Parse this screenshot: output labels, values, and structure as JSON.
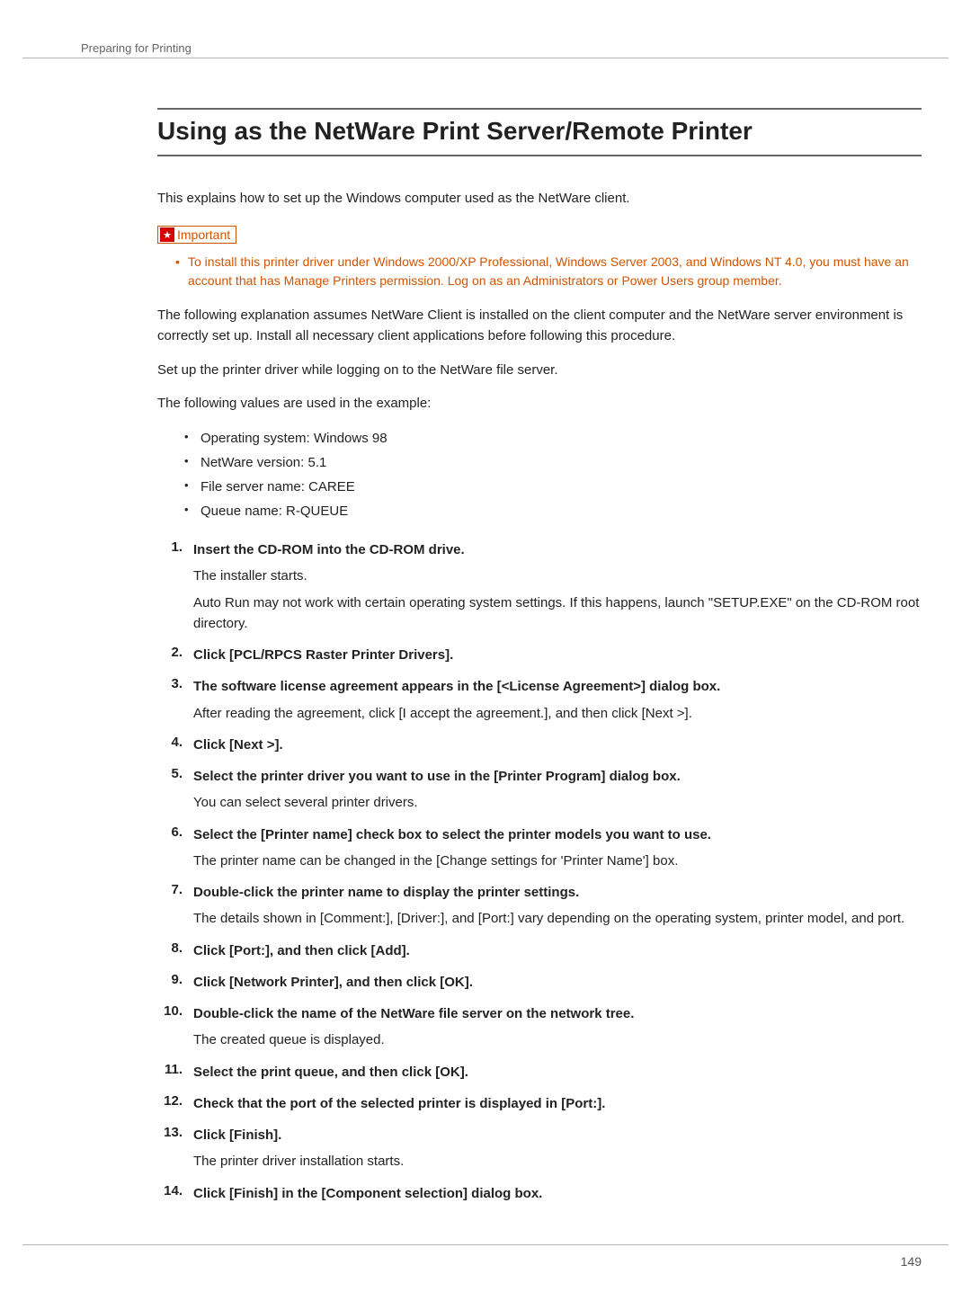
{
  "header": {
    "section": "Preparing for Printing"
  },
  "title": "Using as the NetWare Print Server/Remote Printer",
  "intro": "This explains how to set up the Windows computer used as the NetWare client.",
  "important": {
    "icon_name": "star-icon",
    "label": "Important",
    "bullet": "To install this printer driver under Windows 2000/XP Professional, Windows Server 2003, and Windows NT 4.0, you must have an account that has Manage Printers permission. Log on as an Administrators or Power Users group member."
  },
  "paras": {
    "p1": "The following explanation assumes NetWare Client is installed on the client computer and the NetWare server environment is correctly set up. Install all necessary client applications before following this procedure.",
    "p2": "Set up the printer driver while logging on to the NetWare file server.",
    "p3": "The following values are used in the example:"
  },
  "values": {
    "os": "Operating system: Windows 98",
    "nw": "NetWare version: 5.1",
    "fs": "File server name: CAREE",
    "qn": "Queue name: R-QUEUE"
  },
  "steps": {
    "s1_title": "Insert the CD-ROM into the CD-ROM drive.",
    "s1_body1": "The installer starts.",
    "s1_body2": "Auto Run may not work with certain operating system settings. If this happens, launch \"SETUP.EXE\" on the CD-ROM root directory.",
    "s2_title": "Click [PCL/RPCS Raster Printer Drivers].",
    "s3_title": "The software license agreement appears in the [<License Agreement>] dialog box.",
    "s3_body1": "After reading the agreement, click [I accept the agreement.], and then click [Next >].",
    "s4_title": "Click [Next >].",
    "s5_title": "Select the printer driver you want to use in the [Printer Program] dialog box.",
    "s5_body1": "You can select several printer drivers.",
    "s6_title": "Select the [Printer name] check box to select the printer models you want to use.",
    "s6_body1": "The printer name can be changed in the [Change settings for 'Printer Name'] box.",
    "s7_title": "Double-click the printer name to display the printer settings.",
    "s7_body1": "The details shown in [Comment:], [Driver:], and [Port:] vary depending on the operating system, printer model, and port.",
    "s8_title": "Click [Port:], and then click [Add].",
    "s9_title": "Click [Network Printer], and then click [OK].",
    "s10_title": "Double-click the name of the NetWare file server on the network tree.",
    "s10_body1": "The created queue is displayed.",
    "s11_title": "Select the print queue, and then click [OK].",
    "s12_title": "Check that the port of the selected printer is displayed in [Port:].",
    "s13_title": "Click [Finish].",
    "s13_body1": "The printer driver installation starts.",
    "s14_title": "Click [Finish] in the [Component selection] dialog box."
  },
  "page_number": "149"
}
